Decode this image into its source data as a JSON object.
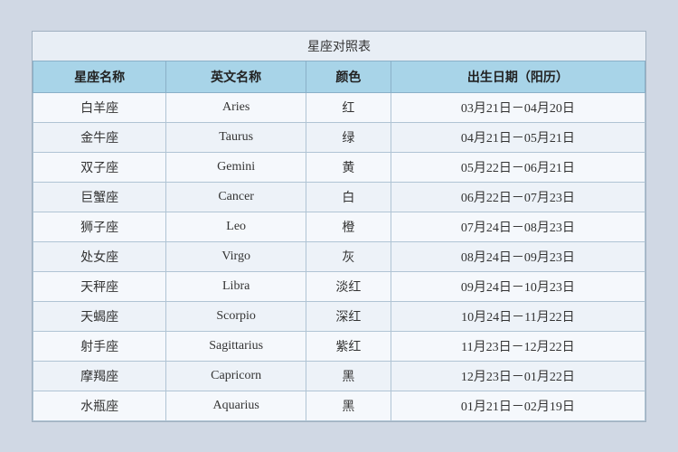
{
  "title": "星座对照表",
  "table": {
    "headers": [
      "星座名称",
      "英文名称",
      "颜色",
      "出生日期（阳历）"
    ],
    "rows": [
      {
        "chinese": "白羊座",
        "english": "Aries",
        "color": "红",
        "dates": "03月21日－04月20日"
      },
      {
        "chinese": "金牛座",
        "english": "Taurus",
        "color": "绿",
        "dates": "04月21日－05月21日"
      },
      {
        "chinese": "双子座",
        "english": "Gemini",
        "color": "黄",
        "dates": "05月22日－06月21日"
      },
      {
        "chinese": "巨蟹座",
        "english": "Cancer",
        "color": "白",
        "dates": "06月22日－07月23日"
      },
      {
        "chinese": "狮子座",
        "english": "Leo",
        "color": "橙",
        "dates": "07月24日－08月23日"
      },
      {
        "chinese": "处女座",
        "english": "Virgo",
        "color": "灰",
        "dates": "08月24日－09月23日"
      },
      {
        "chinese": "天秤座",
        "english": "Libra",
        "color": "淡红",
        "dates": "09月24日－10月23日"
      },
      {
        "chinese": "天蝎座",
        "english": "Scorpio",
        "color": "深红",
        "dates": "10月24日－11月22日"
      },
      {
        "chinese": "射手座",
        "english": "Sagittarius",
        "color": "紫红",
        "dates": "11月23日－12月22日"
      },
      {
        "chinese": "摩羯座",
        "english": "Capricorn",
        "color": "黑",
        "dates": "12月23日－01月22日"
      },
      {
        "chinese": "水瓶座",
        "english": "Aquarius",
        "color": "黑",
        "dates": "01月21日－02月19日"
      }
    ]
  }
}
